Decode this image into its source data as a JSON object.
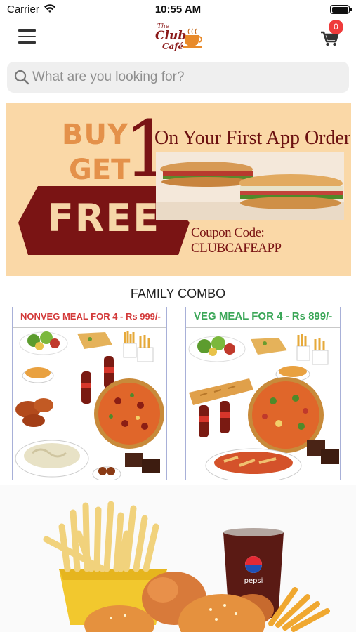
{
  "status_bar": {
    "carrier": "Carrier",
    "time": "10:55 AM"
  },
  "header": {
    "logo_line1": "The",
    "logo_line2": "Club",
    "logo_line3": "Café",
    "cart_count": "0"
  },
  "search": {
    "placeholder": "What are you looking for?"
  },
  "promo_banner": {
    "buy": "BUY",
    "one": "1",
    "get": "GET",
    "free": "FREE",
    "headline": "On Your First App Order",
    "coupon": "Coupon Code: CLUBCAFEAPP"
  },
  "family_combo": {
    "title": "FAMILY COMBO",
    "items": [
      {
        "label": "NONVEG MEAL FOR 4  - Rs 999/-"
      },
      {
        "label": "VEG MEAL FOR 4  - Rs 899/-"
      }
    ]
  },
  "fastfood_banner": {
    "cup_brand": "pepsi"
  },
  "colors": {
    "banner_bg": "#fad8a7",
    "maroon": "#7a1414",
    "orange": "#e4914a",
    "badge_red": "#ef3b3b",
    "nonveg_red": "#d33a3a",
    "veg_green": "#3aa657"
  }
}
